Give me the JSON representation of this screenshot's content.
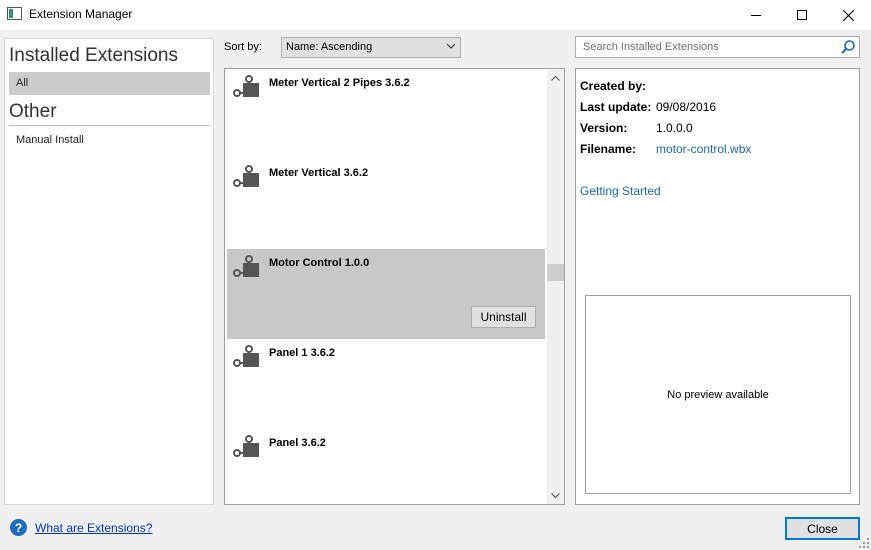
{
  "window": {
    "title": "Extension Manager"
  },
  "sidebar": {
    "sections": [
      {
        "title": "Installed Extensions",
        "items": [
          {
            "label": "All",
            "selected": true
          }
        ]
      },
      {
        "title": "Other",
        "items": [
          {
            "label": "Manual Install",
            "selected": false
          }
        ]
      }
    ]
  },
  "sort": {
    "label": "Sort by:",
    "value": "Name: Ascending"
  },
  "search": {
    "placeholder": "Search Installed Extensions"
  },
  "extensions": [
    {
      "name": "Meter Vertical 2 Pipes 3.6.2",
      "selected": false
    },
    {
      "name": "Meter Vertical 3.6.2",
      "selected": false
    },
    {
      "name": "Motor Control 1.0.0",
      "selected": true,
      "uninstall_label": "Uninstall"
    },
    {
      "name": "Panel 1 3.6.2",
      "selected": false
    },
    {
      "name": "Panel 3.6.2",
      "selected": false
    }
  ],
  "details": {
    "created_by_label": "Created by:",
    "created_by_value": "",
    "last_update_label": "Last update:",
    "last_update_value": "09/08/2016",
    "version_label": "Version:",
    "version_value": "1.0.0.0",
    "filename_label": "Filename:",
    "filename_value": "motor-control.wbx",
    "getting_started": "Getting Started",
    "preview_text": "No preview available"
  },
  "footer": {
    "help_link": "What are Extensions?",
    "close_label": "Close"
  },
  "colors": {
    "selection": "#c8c8c8",
    "link": "#1a6ab0",
    "accent": "#0078d7"
  }
}
